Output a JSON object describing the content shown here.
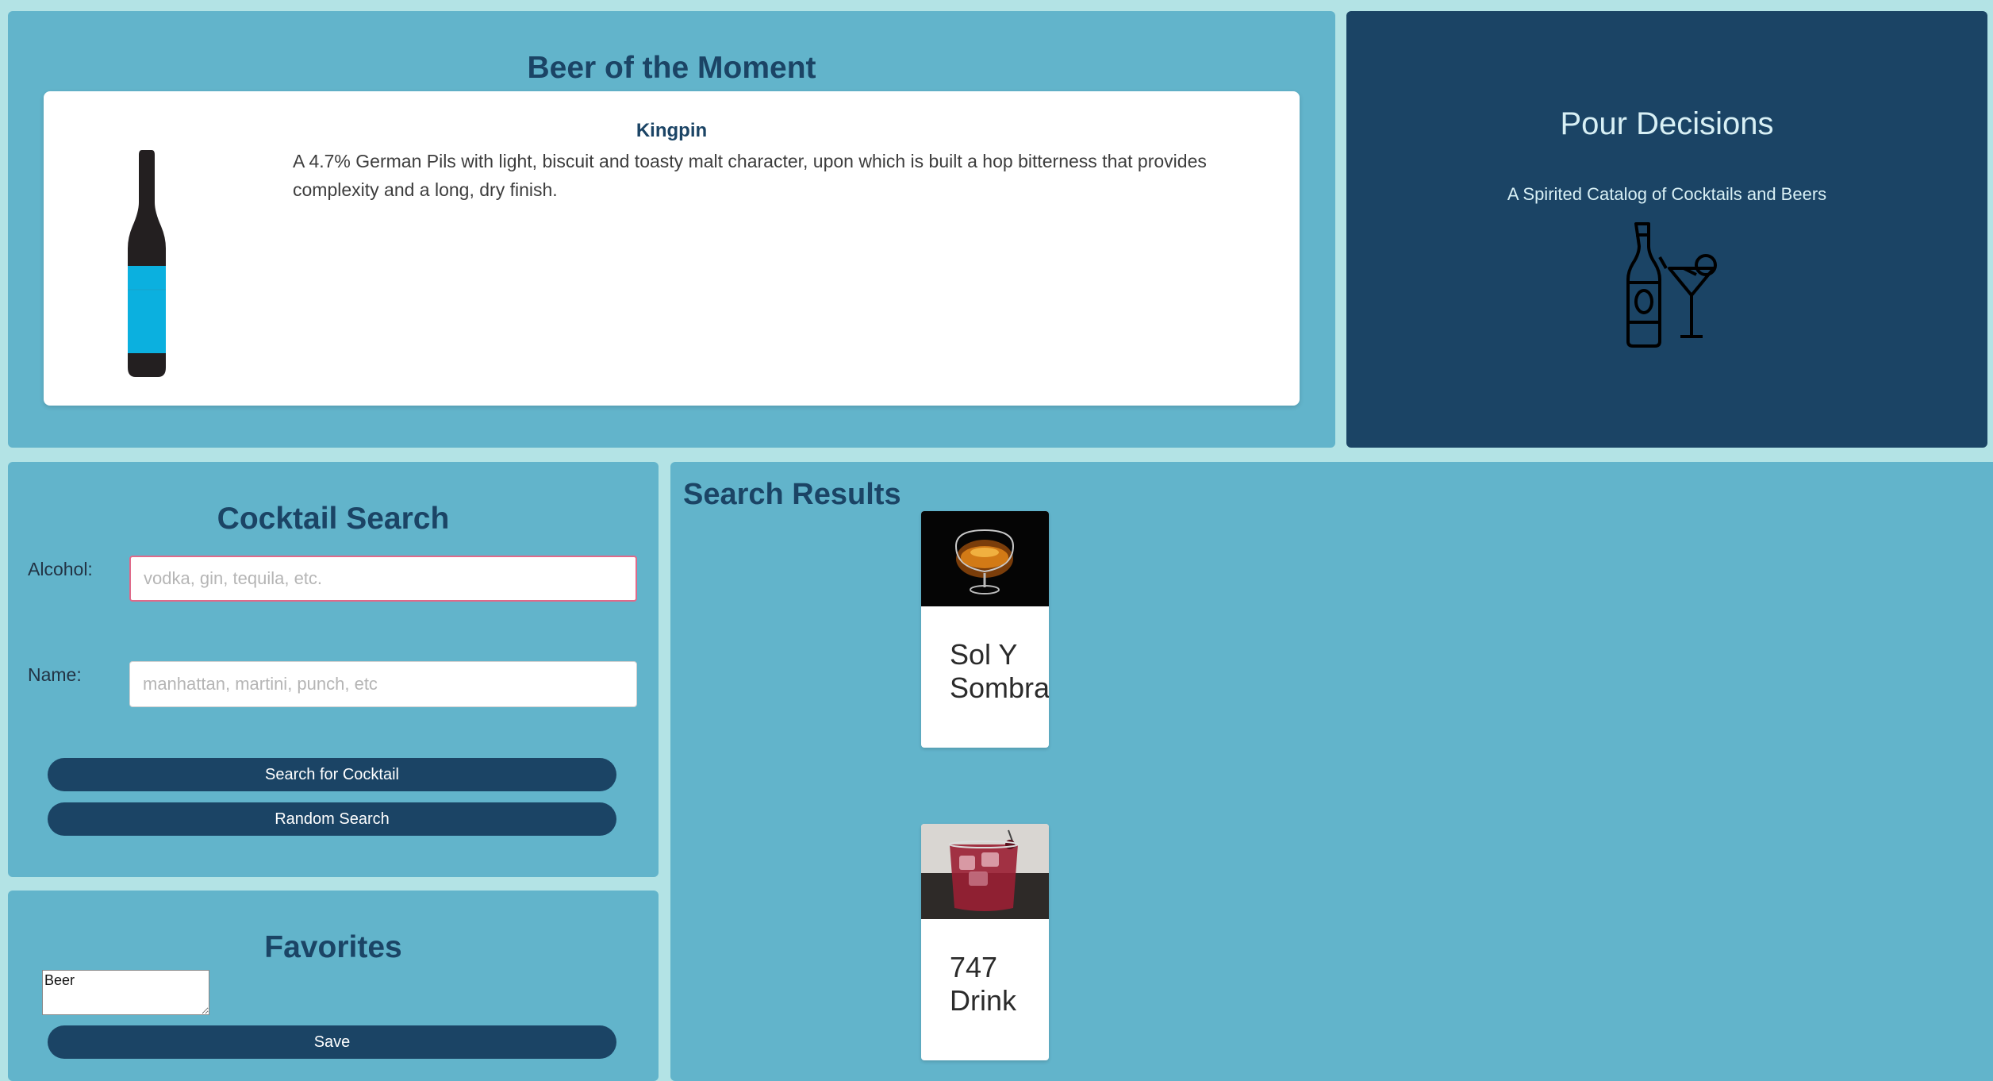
{
  "beer_of_moment": {
    "heading": "Beer of the Moment",
    "name": "Kingpin",
    "description": "A 4.7% German Pils with light, biscuit and toasty malt character, upon which is built a hop bitterness that provides complexity and a long, dry finish.",
    "bottle_icon": "beer-bottle-icon",
    "bottle_colors": {
      "body": "#231f20",
      "label": "#0bb0df"
    }
  },
  "brand": {
    "title": "Pour Decisions",
    "subtitle": "A Spirited Catalog of Cocktails and Beers",
    "logo_icon": "bottle-and-cocktail-glass-icon"
  },
  "cocktail_search": {
    "heading": "Cocktail Search",
    "alcohol_label": "Alcohol:",
    "alcohol_placeholder": "vodka, gin, tequila, etc.",
    "alcohol_value": "",
    "name_label": "Name:",
    "name_placeholder": "manhattan, martini, punch, etc",
    "name_value": "",
    "search_button": "Search for Cocktail",
    "random_button": "Random Search"
  },
  "favorites": {
    "heading": "Favorites",
    "textarea_value": "Beer",
    "save_button": "Save"
  },
  "results": {
    "heading": "Search Results",
    "items": [
      {
        "name": "Sol Y Sombra",
        "image_icon": "brandy-snifter-photo"
      },
      {
        "name": "747 Drink",
        "image_icon": "red-drink-rocks-glass-photo"
      }
    ]
  },
  "colors": {
    "page_bg": "#b3e3e5",
    "panel_bg": "#62b4cb",
    "dark_accent": "#1b4465",
    "card_bg": "#ffffff"
  }
}
